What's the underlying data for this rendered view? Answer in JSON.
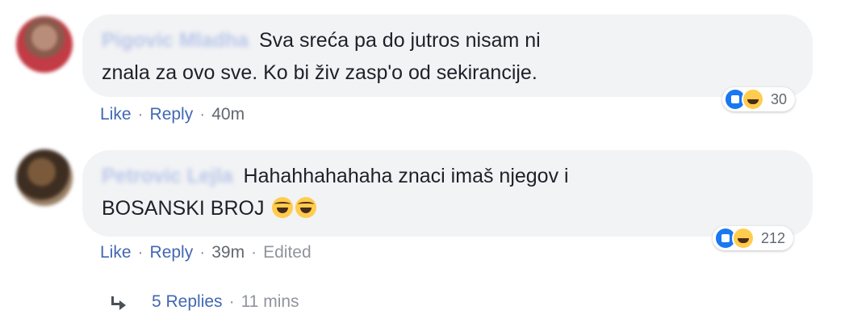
{
  "comments": [
    {
      "author": "Pigovic Mladha",
      "text": "Sva sreća pa do jutros nisam ni znala za ovo sve. Ko bi živ zasp'o od sekirancije.",
      "reaction_count": "30",
      "actions": {
        "like": "Like",
        "reply": "Reply",
        "time": "40m"
      }
    },
    {
      "author": "Petrovic Lejla",
      "text": "Hahahhahahaha znaci imaš njegov i BOSANSKI BROJ",
      "reaction_count": "212",
      "actions": {
        "like": "Like",
        "reply": "Reply",
        "time": "39m",
        "edited": "Edited"
      }
    }
  ],
  "replies_bar": {
    "label": "5 Replies",
    "time": "11 mins"
  },
  "separator": "·"
}
